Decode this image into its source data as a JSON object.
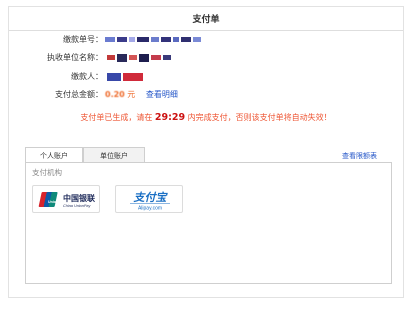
{
  "page": {
    "title": "支付单"
  },
  "info": {
    "order_no_label": "缴款单号：",
    "org_name_label": "执收单位名称：",
    "payer_label": "缴款人：",
    "total_label": "支付总金额：",
    "amount_value": "0.20",
    "amount_unit": "元",
    "detail_link": "查看明细"
  },
  "notice": {
    "prefix": "支付单已生成，请在",
    "timer": "29:29",
    "suffix": "内完成支付，否则该支付单将自动失效！"
  },
  "tabs": [
    {
      "label": "个人账户",
      "active": true
    },
    {
      "label": "单位账户",
      "active": false
    }
  ],
  "view_limit_link": "查看限额表",
  "panel": {
    "label": "支付机构"
  },
  "payment_methods": [
    {
      "name": "unionpay",
      "cn": "中国银联",
      "en": "China UnionPay",
      "logo_mark": "UnionPay"
    },
    {
      "name": "alipay",
      "cn": "支付宝",
      "en": "Alipay.com"
    }
  ],
  "colors": {
    "notice": "#ee5533",
    "link": "#2456c8",
    "alipay_blue": "#1a6fc4",
    "unionpay_red": "#d7232c",
    "unionpay_blue": "#0b5aa8",
    "unionpay_green": "#0f8a7a"
  }
}
